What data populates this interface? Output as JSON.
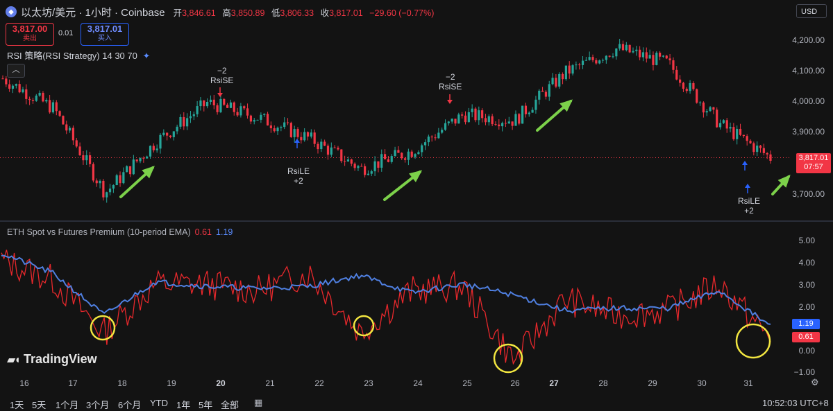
{
  "header": {
    "title": "以太坊/美元 · 1小时 · Coinbase",
    "open_label": "开",
    "open": "3,846.61",
    "high_label": "高",
    "high": "3,850.89",
    "low_label": "低",
    "low": "3,806.33",
    "close_label": "收",
    "close": "3,817.01",
    "change": "−29.60 (−0.77%)",
    "currency": "USD"
  },
  "trade": {
    "sell_price": "3,817.00",
    "sell_label": "卖出",
    "spread": "0.01",
    "buy_price": "3,817.01",
    "buy_label": "买入"
  },
  "strategy": {
    "label": "RSI 策略(RSI Strategy) 14 30 70"
  },
  "price_axis": {
    "labels": [
      "4,200.00",
      "4,100.00",
      "4,000.00",
      "3,900.00",
      "3,700.00"
    ],
    "last_price": "3,817.01",
    "countdown": "07:57"
  },
  "signals": [
    {
      "count": "−2",
      "name": "RsiSE"
    },
    {
      "count": "+2",
      "name": "RsiLE"
    },
    {
      "count": "−2",
      "name": "RsiSE"
    },
    {
      "count": "+2",
      "name": "RsiLE"
    }
  ],
  "indicator": {
    "title": "ETH Spot vs Futures Premium (10-period EMA)",
    "value_red": "0.61",
    "value_blue": "1.19",
    "axis": [
      "5.00",
      "4.00",
      "3.00",
      "2.00",
      "0.00",
      "−1.00"
    ]
  },
  "xaxis": [
    "16",
    "17",
    "18",
    "19",
    "20",
    "21",
    "22",
    "23",
    "24",
    "25",
    "26",
    "27",
    "28",
    "29",
    "30",
    "31"
  ],
  "xaxis_bold": [
    "20",
    "27"
  ],
  "timeframes": [
    "1天",
    "5天",
    "1个月",
    "3个月",
    "6个月",
    "YTD",
    "1年",
    "5年",
    "全部"
  ],
  "clock": "10:52:03 UTC+8",
  "brand": "TradingView",
  "colors": {
    "up": "#26a69a",
    "down": "#f23645",
    "ema": "#4f7fe0",
    "premium": "#e8282c",
    "arrow": "#7cd14a",
    "circle": "#f2e640"
  },
  "chart_data": [
    {
      "type": "line",
      "title": "以太坊/美元 · 1小时 · Coinbase",
      "ylabel": "USD",
      "x": [
        "16",
        "17",
        "18",
        "19",
        "20",
        "21",
        "22",
        "23",
        "24",
        "25",
        "26",
        "27",
        "28",
        "29",
        "30",
        "31"
      ],
      "ylim": [
        3650,
        4260
      ],
      "series": [
        {
          "name": "ETH/USD",
          "values": [
            4080,
            3980,
            3700,
            3870,
            4000,
            3950,
            3880,
            3780,
            3840,
            3960,
            3940,
            4100,
            4180,
            4130,
            3930,
            3817
          ]
        }
      ]
    },
    {
      "type": "line",
      "title": "ETH Spot vs Futures Premium (10-period EMA)",
      "x": [
        "16",
        "17",
        "18",
        "19",
        "20",
        "21",
        "22",
        "23",
        "24",
        "25",
        "26",
        "27",
        "28",
        "29",
        "30",
        "31"
      ],
      "ylim": [
        -1,
        5.3
      ],
      "series": [
        {
          "name": "",
          "values": [
            4.5,
            3.6,
            1.7,
            3.2,
            3.0,
            2.9,
            3.0,
            3.5,
            2.7,
            3.1,
            2.6,
            1.9,
            2.0,
            2.0,
            2.8,
            1.19
          ]
        },
        {
          "name": "",
          "values": [
            4.2,
            3.3,
            0.9,
            3.1,
            3.1,
            2.8,
            3.6,
            0.9,
            2.8,
            3.0,
            -0.4,
            2.4,
            1.7,
            1.9,
            3.1,
            0.61
          ]
        }
      ]
    }
  ]
}
